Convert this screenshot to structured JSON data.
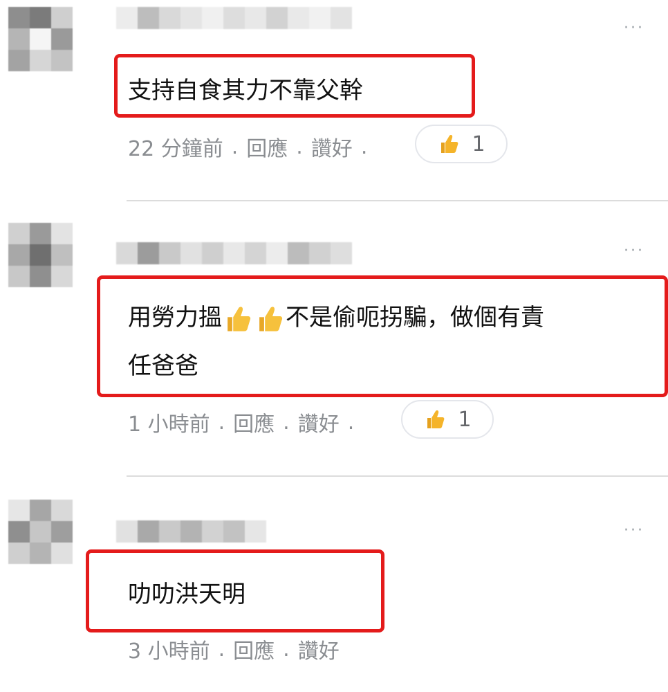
{
  "more_label": "···",
  "comments": [
    {
      "text": "支持自食其力不靠父幹",
      "text_line2": "",
      "time": "22 分鐘前",
      "reply": "回應",
      "like": "讚好",
      "sep": ".",
      "reactions": "1"
    },
    {
      "text": "用勞力搵",
      "text_after": "不是偷呃拐騙，做個有責",
      "text_line2": "任爸爸",
      "time": "1 小時前",
      "reply": "回應",
      "like": "讚好",
      "sep": ".",
      "reactions": "1"
    },
    {
      "text": "叻叻洪天明",
      "text_line2": "",
      "time": "3 小時前",
      "reply": "回應",
      "like": "讚好",
      "sep": "."
    }
  ],
  "colors": {
    "highlight_box": "#e41b1b",
    "meta_text": "#8a8d91",
    "thumb_emoji": "#f5b42a"
  },
  "icons": [
    "thumbs-up-icon",
    "more-options-icon"
  ]
}
